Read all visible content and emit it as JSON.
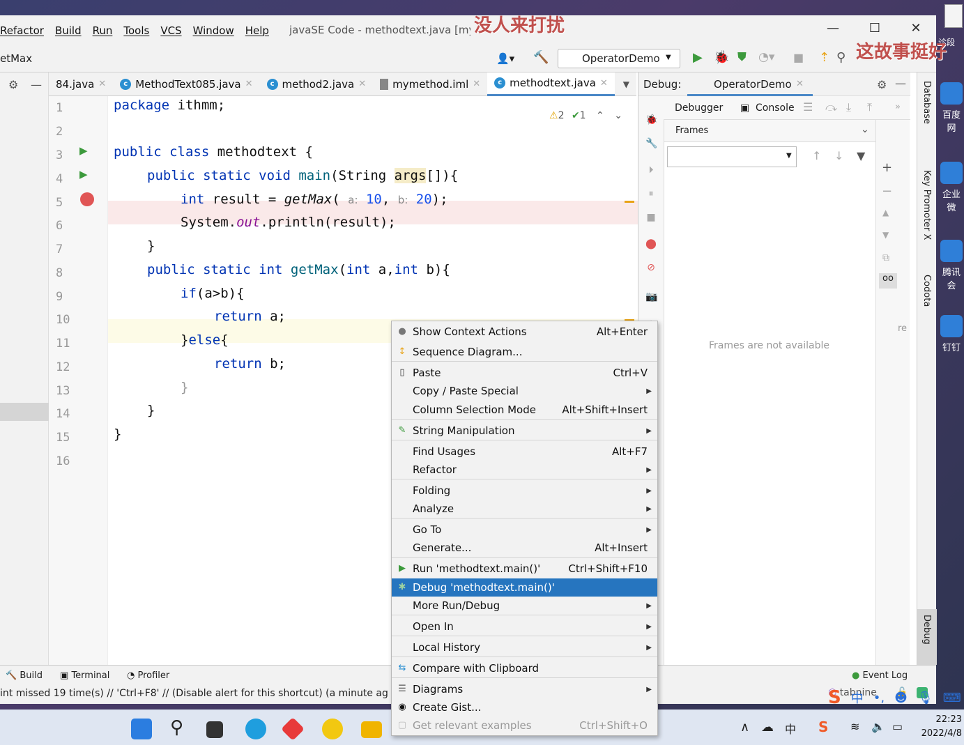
{
  "menu": {
    "items": [
      "Refactor",
      "Build",
      "Run",
      "Tools",
      "VCS",
      "Window",
      "Help"
    ],
    "window_title": "javaSE Code - methodtext.java [mym"
  },
  "overlay": {
    "top": "没人来打扰",
    "right": "这故事挺好"
  },
  "navbar": {
    "breadcrumb": "etMax",
    "run_config": "OperatorDemo"
  },
  "tabs": [
    {
      "label": "84.java"
    },
    {
      "label": "MethodText085.java"
    },
    {
      "label": "method2.java"
    },
    {
      "label": "mymethod.iml"
    },
    {
      "label": "methodtext.java",
      "active": true
    }
  ],
  "editor": {
    "inspections": {
      "warnings": "2",
      "ok": "1"
    },
    "line_numbers": [
      "1",
      "2",
      "3",
      "4",
      "5",
      "6",
      "7",
      "8",
      "9",
      "10",
      "11",
      "12",
      "13",
      "14",
      "15",
      "16"
    ],
    "hint_a": "a:",
    "hint_b": "b:"
  },
  "debug": {
    "title": "Debug:",
    "config": "OperatorDemo",
    "tab_debugger": "Debugger",
    "tab_console": "Console",
    "frames_label": "Frames",
    "frames_empty": "Frames are not available",
    "truncated": "re n"
  },
  "right_strip": [
    "Database",
    "Key Promoter X",
    "Codota",
    "Debug"
  ],
  "context_menu": [
    {
      "label": "Show Context Actions",
      "shortcut": "Alt+Enter",
      "icon": "bulb-icon"
    },
    {
      "label": "Sequence Diagram...",
      "icon": "sequence-diagram-icon"
    },
    {
      "label": "Paste",
      "shortcut": "Ctrl+V",
      "icon": "paste-icon"
    },
    {
      "label": "Copy / Paste Special",
      "submenu": true
    },
    {
      "label": "Column Selection Mode",
      "shortcut": "Alt+Shift+Insert"
    },
    {
      "label": "String Manipulation",
      "submenu": true,
      "icon": "pencil-icon"
    },
    {
      "label": "Find Usages",
      "shortcut": "Alt+F7"
    },
    {
      "label": "Refactor",
      "submenu": true
    },
    {
      "label": "Folding",
      "submenu": true
    },
    {
      "label": "Analyze",
      "submenu": true
    },
    {
      "label": "Go To",
      "submenu": true
    },
    {
      "label": "Generate...",
      "shortcut": "Alt+Insert"
    },
    {
      "label": "Run 'methodtext.main()'",
      "shortcut": "Ctrl+Shift+F10",
      "icon": "run-icon"
    },
    {
      "label": "Debug 'methodtext.main()'",
      "selected": true,
      "icon": "debug-icon"
    },
    {
      "label": "More Run/Debug",
      "submenu": true
    },
    {
      "label": "Open In",
      "submenu": true
    },
    {
      "label": "Local History",
      "submenu": true
    },
    {
      "label": "Compare with Clipboard",
      "icon": "compare-icon"
    },
    {
      "label": "Diagrams",
      "submenu": true,
      "icon": "diagram-icon"
    },
    {
      "label": "Create Gist...",
      "icon": "github-icon"
    },
    {
      "label": "Get relevant examples",
      "shortcut": "Ctrl+Shift+O",
      "disabled": true,
      "icon": "examples-icon"
    }
  ],
  "bottom_tabs": {
    "build": "Build",
    "terminal": "Terminal",
    "profiler": "Profiler",
    "event_log": "Event Log"
  },
  "status": {
    "message": "int missed 19 time(s) // 'Ctrl+F8' // (Disable alert for this shortcut) (a minute ag",
    "tabnine": "tabnine"
  },
  "desktop": {
    "icons": [
      "百度网",
      "企业微",
      "腾讯会",
      "钉钉"
    ],
    "top_right_fragment": "诊段"
  },
  "taskbar": {
    "time": "22:23",
    "date": "2022/4/8",
    "ime": "中"
  },
  "colors": {
    "accent": "#2675bf",
    "keyword": "#0033b3",
    "breakpoint": "#e05555"
  }
}
